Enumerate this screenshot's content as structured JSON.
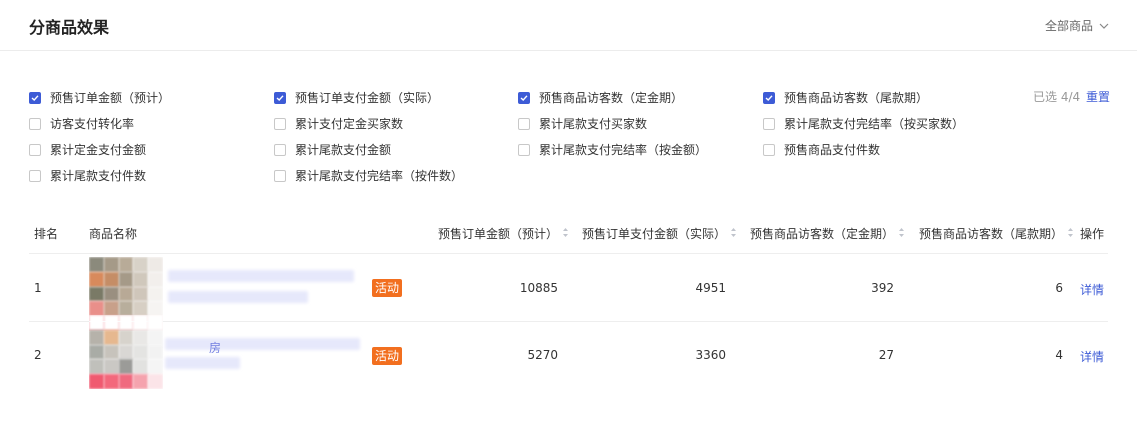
{
  "header": {
    "title": "分商品效果",
    "scope_select": "全部商品"
  },
  "metrics": [
    {
      "label": "预售订单金额（预计）",
      "checked": true
    },
    {
      "label": "预售订单支付金额（实际）",
      "checked": true
    },
    {
      "label": "预售商品访客数（定金期）",
      "checked": true
    },
    {
      "label": "预售商品访客数（尾款期）",
      "checked": true
    },
    {
      "label": "访客支付转化率",
      "checked": false
    },
    {
      "label": "累计支付定金买家数",
      "checked": false
    },
    {
      "label": "累计尾款支付买家数",
      "checked": false
    },
    {
      "label": "累计尾款支付完结率（按买家数）",
      "checked": false
    },
    {
      "label": "累计定金支付金额",
      "checked": false
    },
    {
      "label": "累计尾款支付金额",
      "checked": false
    },
    {
      "label": "累计尾款支付完结率（按金额）",
      "checked": false
    },
    {
      "label": "预售商品支付件数",
      "checked": false
    },
    {
      "label": "累计尾款支付件数",
      "checked": false
    },
    {
      "label": "累计尾款支付完结率（按件数）",
      "checked": false
    }
  ],
  "selection": {
    "count_text": "已选 4/4",
    "reset_label": "重置"
  },
  "table": {
    "headers": {
      "rank": "排名",
      "name": "商品名称",
      "col1": "预售订单金额（预计）",
      "col2": "预售订单支付金额（实际）",
      "col3": "预售商品访客数（定金期）",
      "col4": "预售商品访客数（尾款期）",
      "action": "操作"
    },
    "rows": [
      {
        "rank": "1",
        "tag": "活动",
        "name_visible": "",
        "col1": "10885",
        "col2": "4951",
        "col3": "392",
        "col4": "6",
        "action": "详情"
      },
      {
        "rank": "2",
        "tag": "活动",
        "name_visible": "房",
        "col1": "5270",
        "col2": "3360",
        "col3": "27",
        "col4": "4",
        "action": "详情"
      }
    ]
  },
  "colors": {
    "accent": "#3d5bd6",
    "tag": "#f26f1f"
  },
  "icons": {
    "scope_select": "chevron-down-icon",
    "sort": "sort-icon",
    "checkbox_checked": "check-icon"
  }
}
